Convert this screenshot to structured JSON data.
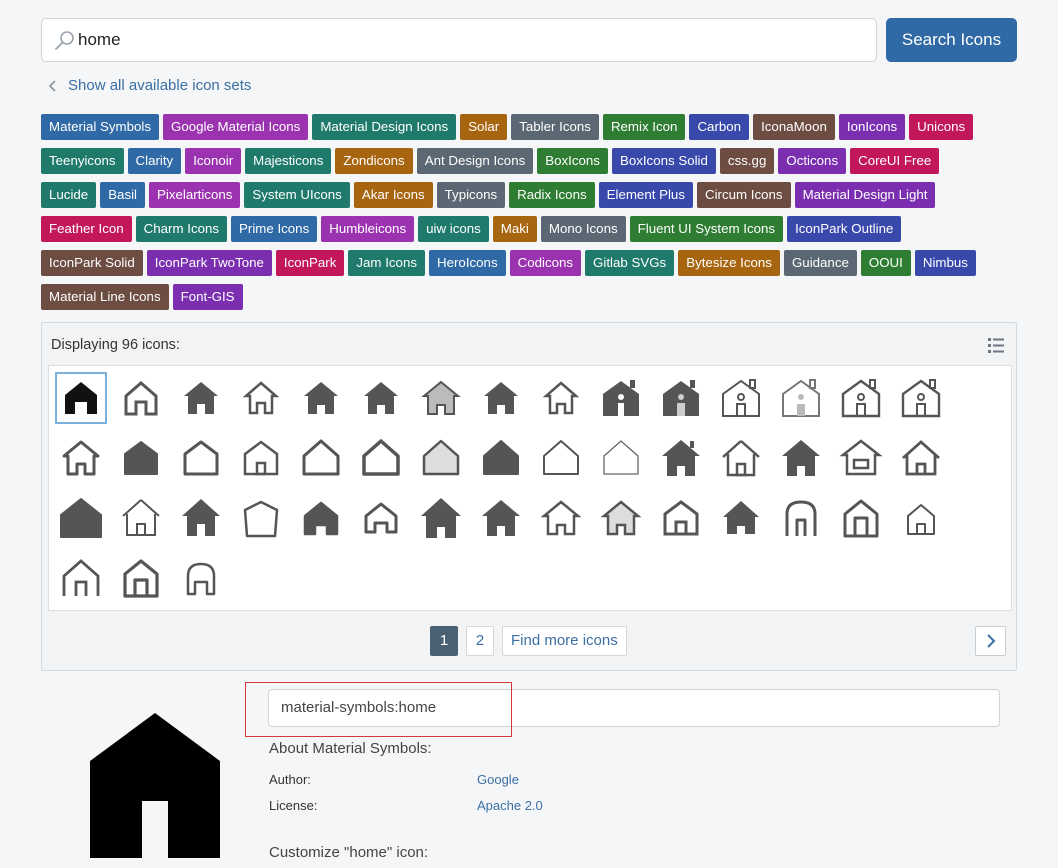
{
  "search": {
    "value": "home",
    "button": "Search Icons"
  },
  "back_link": "Show all available icon sets",
  "tags": [
    {
      "label": "Material Symbols",
      "color": "#2f6aa6"
    },
    {
      "label": "Google Material Icons",
      "color": "#9b32b0"
    },
    {
      "label": "Material Design Icons",
      "color": "#1f7a6c"
    },
    {
      "label": "Solar",
      "color": "#a8650f"
    },
    {
      "label": "Tabler Icons",
      "color": "#5b6873"
    },
    {
      "label": "Remix Icon",
      "color": "#2e7d32"
    },
    {
      "label": "Carbon",
      "color": "#3949ab"
    },
    {
      "label": "IconaMoon",
      "color": "#6d4c41"
    },
    {
      "label": "IonIcons",
      "color": "#7b2fb0"
    },
    {
      "label": "Unicons",
      "color": "#c2185b"
    },
    {
      "label": "Teenyicons",
      "color": "#1f7a6c"
    },
    {
      "label": "Clarity",
      "color": "#2f6aa6"
    },
    {
      "label": "Iconoir",
      "color": "#9b32b0"
    },
    {
      "label": "Majesticons",
      "color": "#1f7a6c"
    },
    {
      "label": "Zondicons",
      "color": "#a8650f"
    },
    {
      "label": "Ant Design Icons",
      "color": "#5b6873"
    },
    {
      "label": "BoxIcons",
      "color": "#2e7d32"
    },
    {
      "label": "BoxIcons Solid",
      "color": "#3949ab"
    },
    {
      "label": "css.gg",
      "color": "#6d4c41"
    },
    {
      "label": "Octicons",
      "color": "#7b2fb0"
    },
    {
      "label": "CoreUI Free",
      "color": "#c2185b"
    },
    {
      "label": "Lucide",
      "color": "#1f7a6c"
    },
    {
      "label": "Basil",
      "color": "#2f6aa6"
    },
    {
      "label": "Pixelarticons",
      "color": "#9b32b0"
    },
    {
      "label": "System UIcons",
      "color": "#1f7a6c"
    },
    {
      "label": "Akar Icons",
      "color": "#a8650f"
    },
    {
      "label": "Typicons",
      "color": "#5b6873"
    },
    {
      "label": "Radix Icons",
      "color": "#2e7d32"
    },
    {
      "label": "Element Plus",
      "color": "#3949ab"
    },
    {
      "label": "Circum Icons",
      "color": "#6d4c41"
    },
    {
      "label": "Material Design Light",
      "color": "#7b2fb0"
    },
    {
      "label": "Feather Icon",
      "color": "#c2185b"
    },
    {
      "label": "Charm Icons",
      "color": "#1f7a6c"
    },
    {
      "label": "Prime Icons",
      "color": "#2f6aa6"
    },
    {
      "label": "Humbleicons",
      "color": "#9b32b0"
    },
    {
      "label": "uiw icons",
      "color": "#1f7a6c"
    },
    {
      "label": "Maki",
      "color": "#a8650f"
    },
    {
      "label": "Mono Icons",
      "color": "#5b6873"
    },
    {
      "label": "Fluent UI System Icons",
      "color": "#2e7d32"
    },
    {
      "label": "IconPark Outline",
      "color": "#3949ab"
    },
    {
      "label": "IconPark Solid",
      "color": "#6d4c41"
    },
    {
      "label": "IconPark TwoTone",
      "color": "#7b2fb0"
    },
    {
      "label": "IconPark",
      "color": "#c2185b"
    },
    {
      "label": "Jam Icons",
      "color": "#1f7a6c"
    },
    {
      "label": "HeroIcons",
      "color": "#2f6aa6"
    },
    {
      "label": "Codicons",
      "color": "#9b32b0"
    },
    {
      "label": "Gitlab SVGs",
      "color": "#1f7a6c"
    },
    {
      "label": "Bytesize Icons",
      "color": "#a8650f"
    },
    {
      "label": "Guidance",
      "color": "#5b6873"
    },
    {
      "label": "OOUI",
      "color": "#2e7d32"
    },
    {
      "label": "Nimbus",
      "color": "#3949ab"
    },
    {
      "label": "Material Line Icons",
      "color": "#6d4c41"
    },
    {
      "label": "Font-GIS",
      "color": "#7b2fb0"
    }
  ],
  "results": {
    "count_text": "Displaying 96 icons:",
    "icon_count": 48
  },
  "pager": {
    "pages": [
      "1",
      "2"
    ],
    "find_more": "Find more icons"
  },
  "selected": {
    "name": "material-symbols:home",
    "about": "About Material Symbols:",
    "author_label": "Author:",
    "author_value": "Google",
    "license_label": "License:",
    "license_value": "Apache 2.0",
    "customize": "Customize \"home\" icon:"
  }
}
